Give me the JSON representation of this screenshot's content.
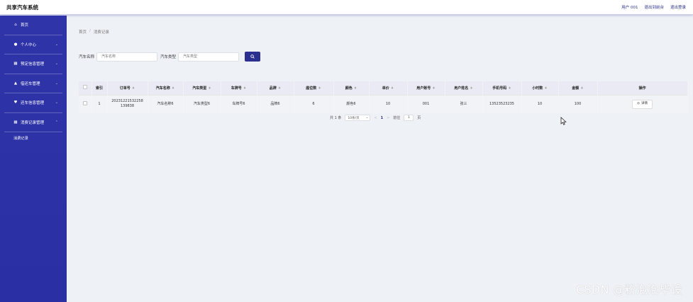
{
  "app": {
    "title": "共享汽车系统"
  },
  "topbar": {
    "user": "用户 001",
    "front_link": "退出到前台",
    "logout": "退出登录"
  },
  "sidebar": {
    "items": [
      {
        "label": "首页",
        "icon": "home-icon",
        "has_arrow": false
      },
      {
        "label": "个人中心",
        "icon": "user-icon",
        "has_arrow": true
      },
      {
        "label": "预定信息管理",
        "icon": "grid-icon",
        "has_arrow": true
      },
      {
        "label": "借还车管理",
        "icon": "car-icon",
        "has_arrow": true
      },
      {
        "label": "还车信息管理",
        "icon": "heart-icon",
        "has_arrow": true
      },
      {
        "label": "消费记录管理",
        "icon": "grid-icon",
        "has_arrow": true
      }
    ],
    "sub_items": [
      {
        "label": "消费记录"
      }
    ]
  },
  "breadcrumb": {
    "home": "首页",
    "separator": "/",
    "current": "消费记录"
  },
  "search": {
    "name_label": "汽车名称",
    "name_placeholder": "汽车名称",
    "type_label": "汽车类型",
    "type_placeholder": "汽车类型",
    "button_icon": "search-icon"
  },
  "table": {
    "columns": [
      "索引",
      "订单号",
      "汽车名称",
      "汽车类型",
      "车牌号",
      "品牌",
      "座位数",
      "颜色",
      "单价",
      "用户账号",
      "用户姓名",
      "手机号码",
      "小时数",
      "金额",
      "操作"
    ],
    "rows": [
      {
        "index": "1",
        "order_no_1": "20231221532258",
        "order_no_2": "139838",
        "car_name": "汽车名称6",
        "car_type": "汽车类型6",
        "plate": "车牌号6",
        "brand": "品牌6",
        "seats": "6",
        "color": "颜色6",
        "price": "10",
        "account": "001",
        "username": "张三",
        "phone": "13523523235",
        "hours": "10",
        "amount": "100",
        "action": "详情"
      }
    ]
  },
  "pager": {
    "total": "共 1 条",
    "page_size": "10条/页",
    "prev": "<",
    "current": "1",
    "next": ">",
    "goto_label": "前往",
    "goto_value": "1",
    "goto_suffix": "页"
  },
  "watermark": "CSDN @粉泡泡毕设",
  "colors": {
    "sidebar": "#2f34a8",
    "accent": "#2b2f8f",
    "table_header": "#e9eaf3"
  }
}
